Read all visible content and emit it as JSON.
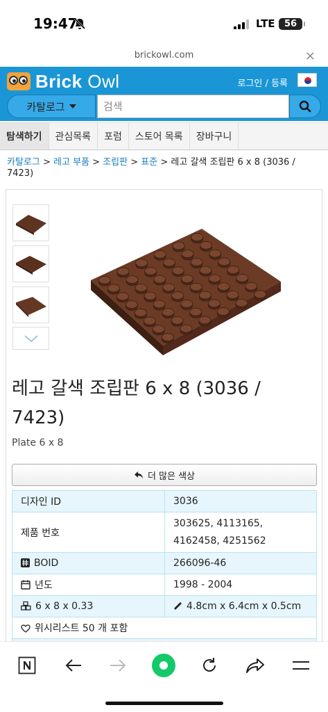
{
  "status_bar": {
    "time": "19:47",
    "network": "LTE",
    "battery": "56"
  },
  "browser": {
    "url": "brickowl.com",
    "close": "×"
  },
  "header": {
    "brand_bold": "Brick",
    "brand_light": "Owl",
    "login": "로그인",
    "separator": "/",
    "register": "등록",
    "catalog_button": "카탈로그",
    "search_placeholder": "검색"
  },
  "tabs": [
    {
      "label": "탐색하기",
      "active": true
    },
    {
      "label": "관심목록"
    },
    {
      "label": "포럼"
    },
    {
      "label": "스토어 목록"
    },
    {
      "label": "장바구니"
    }
  ],
  "breadcrumb": {
    "items": [
      "카탈로그",
      "레고 부품",
      "조립판",
      "표준"
    ],
    "sep": ">",
    "current": "레고 갈색 조립판 6 x 8 (3036 / 7423)"
  },
  "product": {
    "title": "레고 갈색 조립판 6 x 8 (3036 / 7423)",
    "subtitle": "Plate 6 x 8",
    "more_colors": "더 많은 색상"
  },
  "info_rows": [
    {
      "key": "디자인 ID",
      "value": "3036",
      "icon": ""
    },
    {
      "key": "제품 번호",
      "value": "303625, 4113165, 4162458, 4251562",
      "icon": ""
    },
    {
      "key": "BOID",
      "value": "266096-46",
      "icon": "hashtag-icon"
    },
    {
      "key": "년도",
      "value": "1998 - 2004",
      "icon": "calendar-icon"
    },
    {
      "key": "6 x 8 x 0.33",
      "value": "4.8cm x 6.4cm x 0.5cm",
      "icon": "cubes-icon",
      "value_icon": "ruler-icon"
    },
    {
      "key": "위시리스트 50 개 포함",
      "value": "",
      "icon": "heart-icon",
      "span": true
    }
  ],
  "colors": {
    "header_blue": "#1a96d6",
    "brick_brown": "#5e3321",
    "link": "#1a7fc0",
    "table_blue": "#e6f6fc"
  }
}
